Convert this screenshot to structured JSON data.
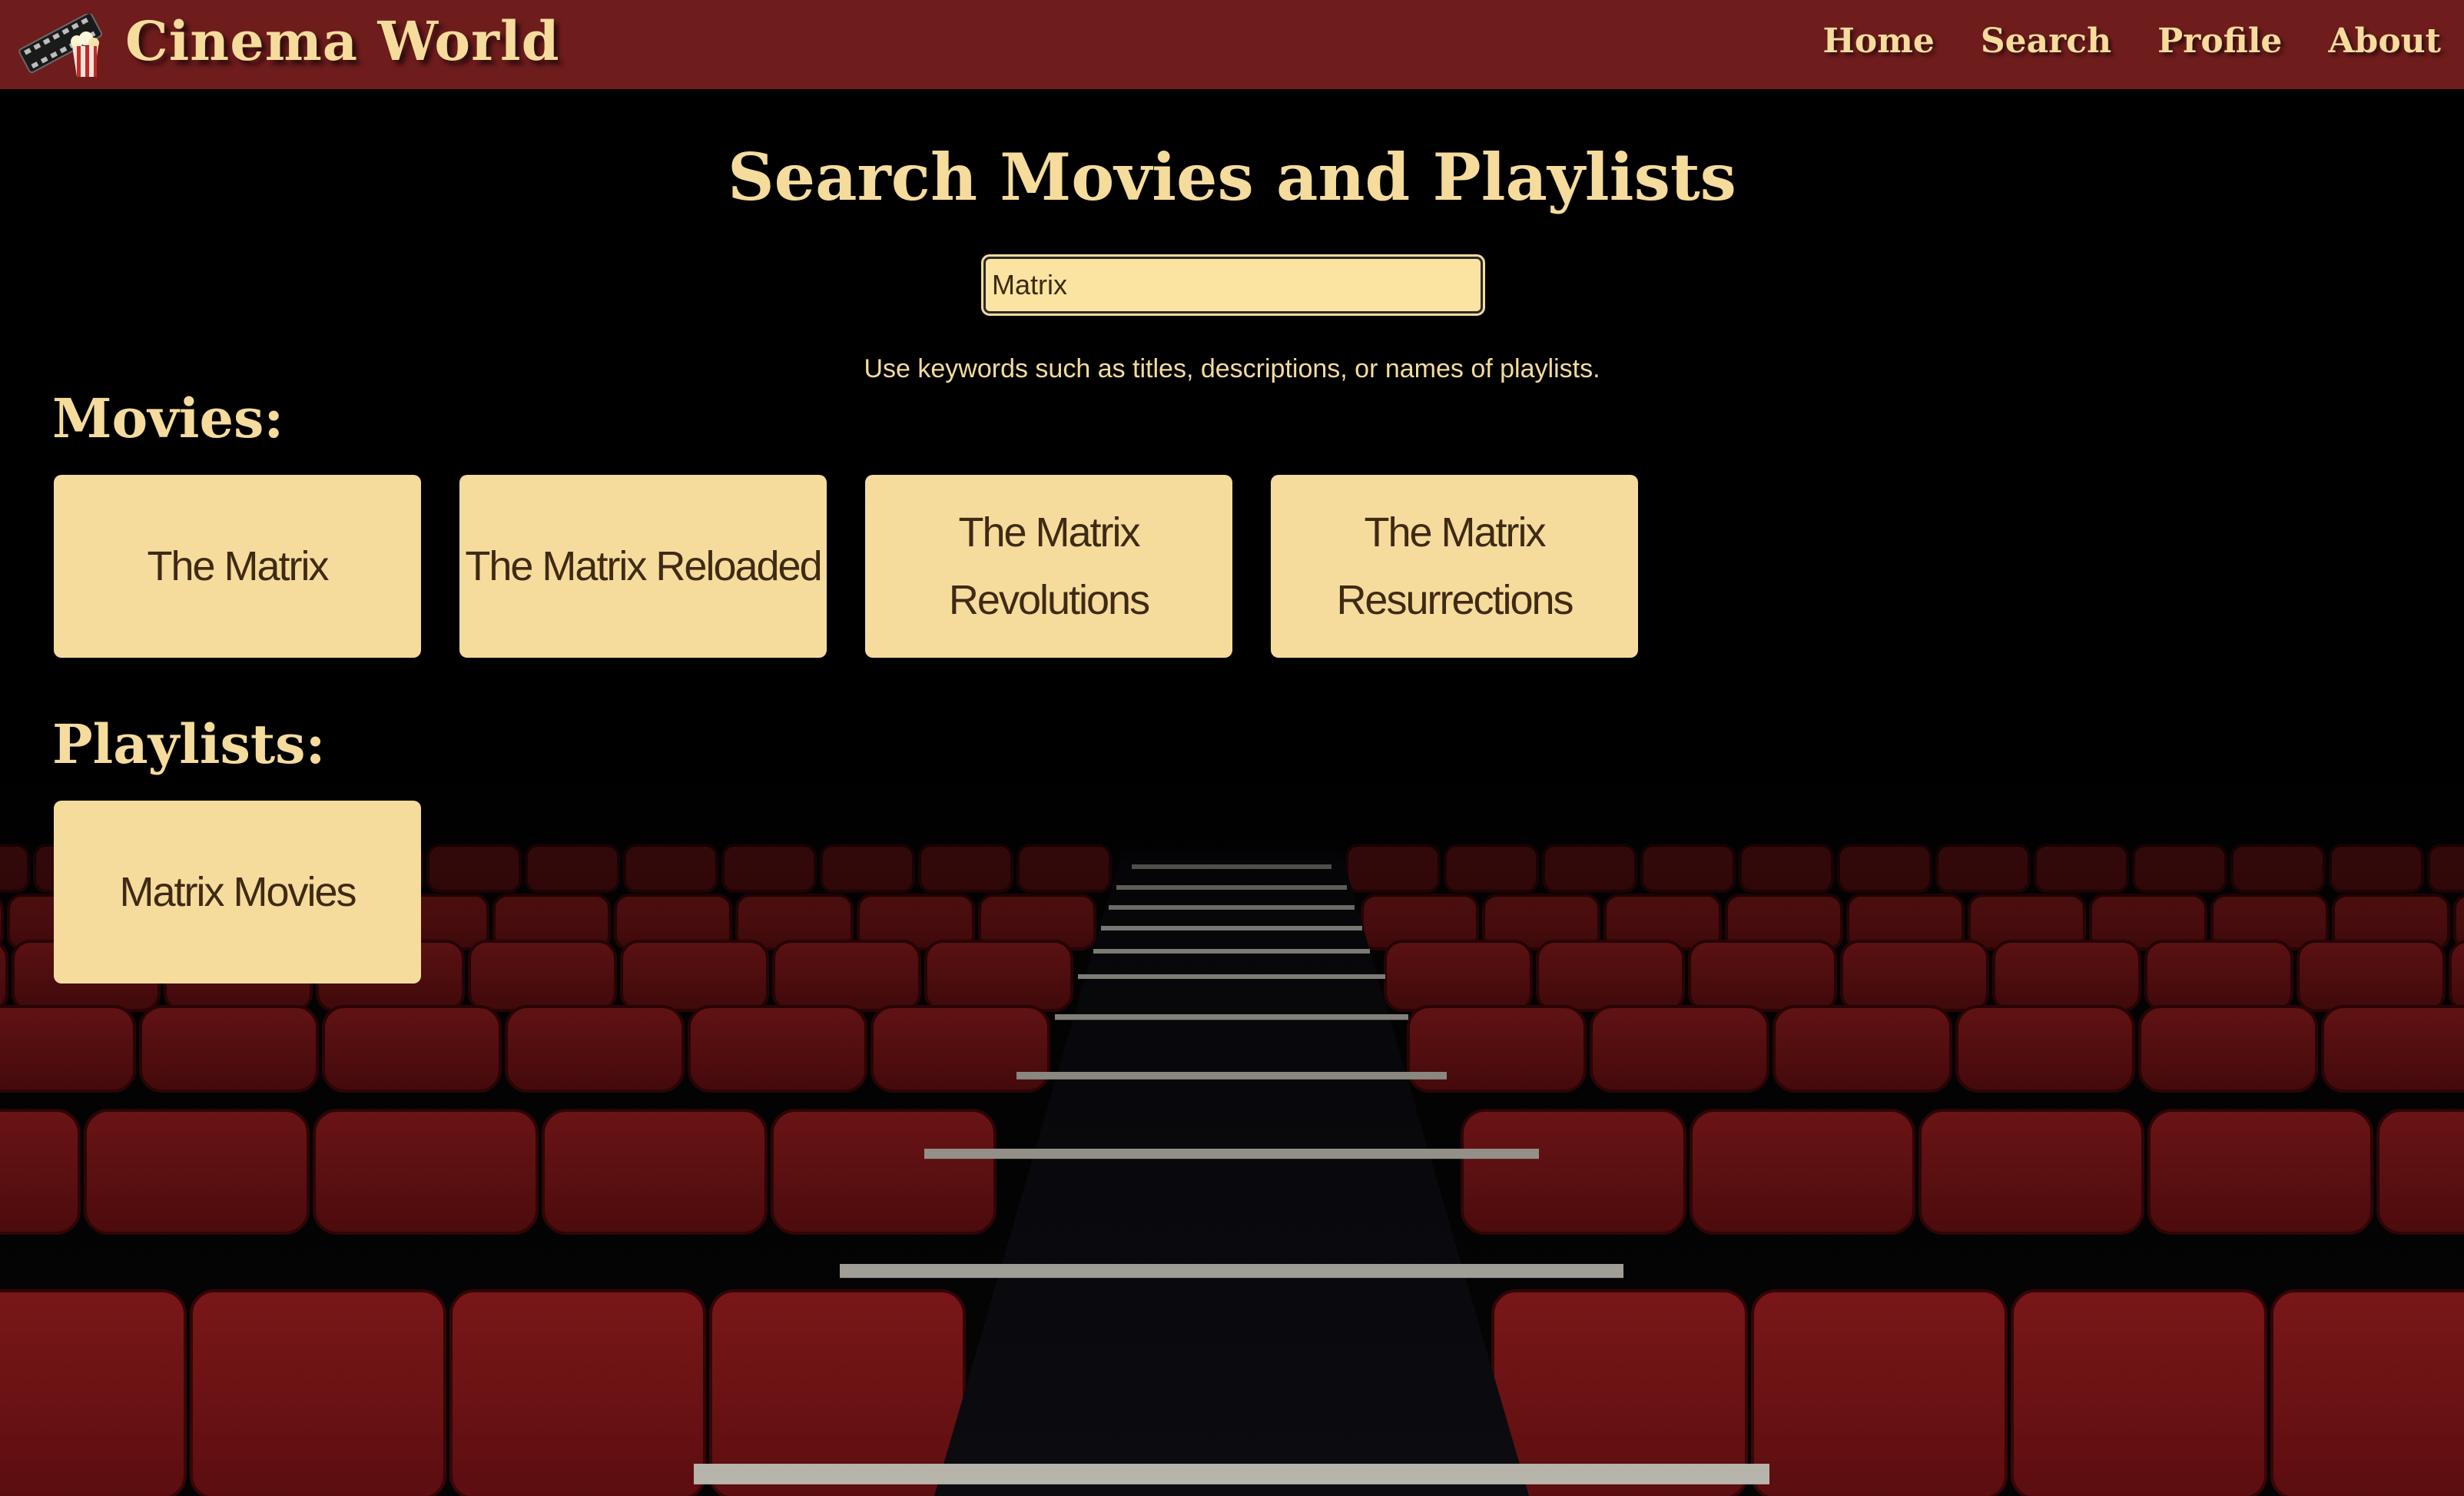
{
  "header": {
    "title": "Cinema World",
    "logo_icon": "film-popcorn-icon",
    "nav": [
      "Home",
      "Search",
      "Profile",
      "About"
    ]
  },
  "search": {
    "page_title": "Search Movies and Playlists",
    "query": "Matrix",
    "hint": "Use keywords such as titles, descriptions, or names of playlists."
  },
  "movies": {
    "heading": "Movies:",
    "items": [
      "The Matrix",
      "The Matrix Reloaded",
      "The Matrix Revolutions",
      "The Matrix Resurrections"
    ]
  },
  "playlists": {
    "heading": "Playlists:",
    "items": [
      "Matrix Movies"
    ]
  },
  "colors": {
    "header_bg": "#6e1c1c",
    "accent_text": "#f5dc9c",
    "card_bg": "#f5dc9c",
    "card_text": "#3f2a14",
    "seat_red": "#7a1416"
  },
  "background_image": "theater-seats-with-aisle-stairs"
}
